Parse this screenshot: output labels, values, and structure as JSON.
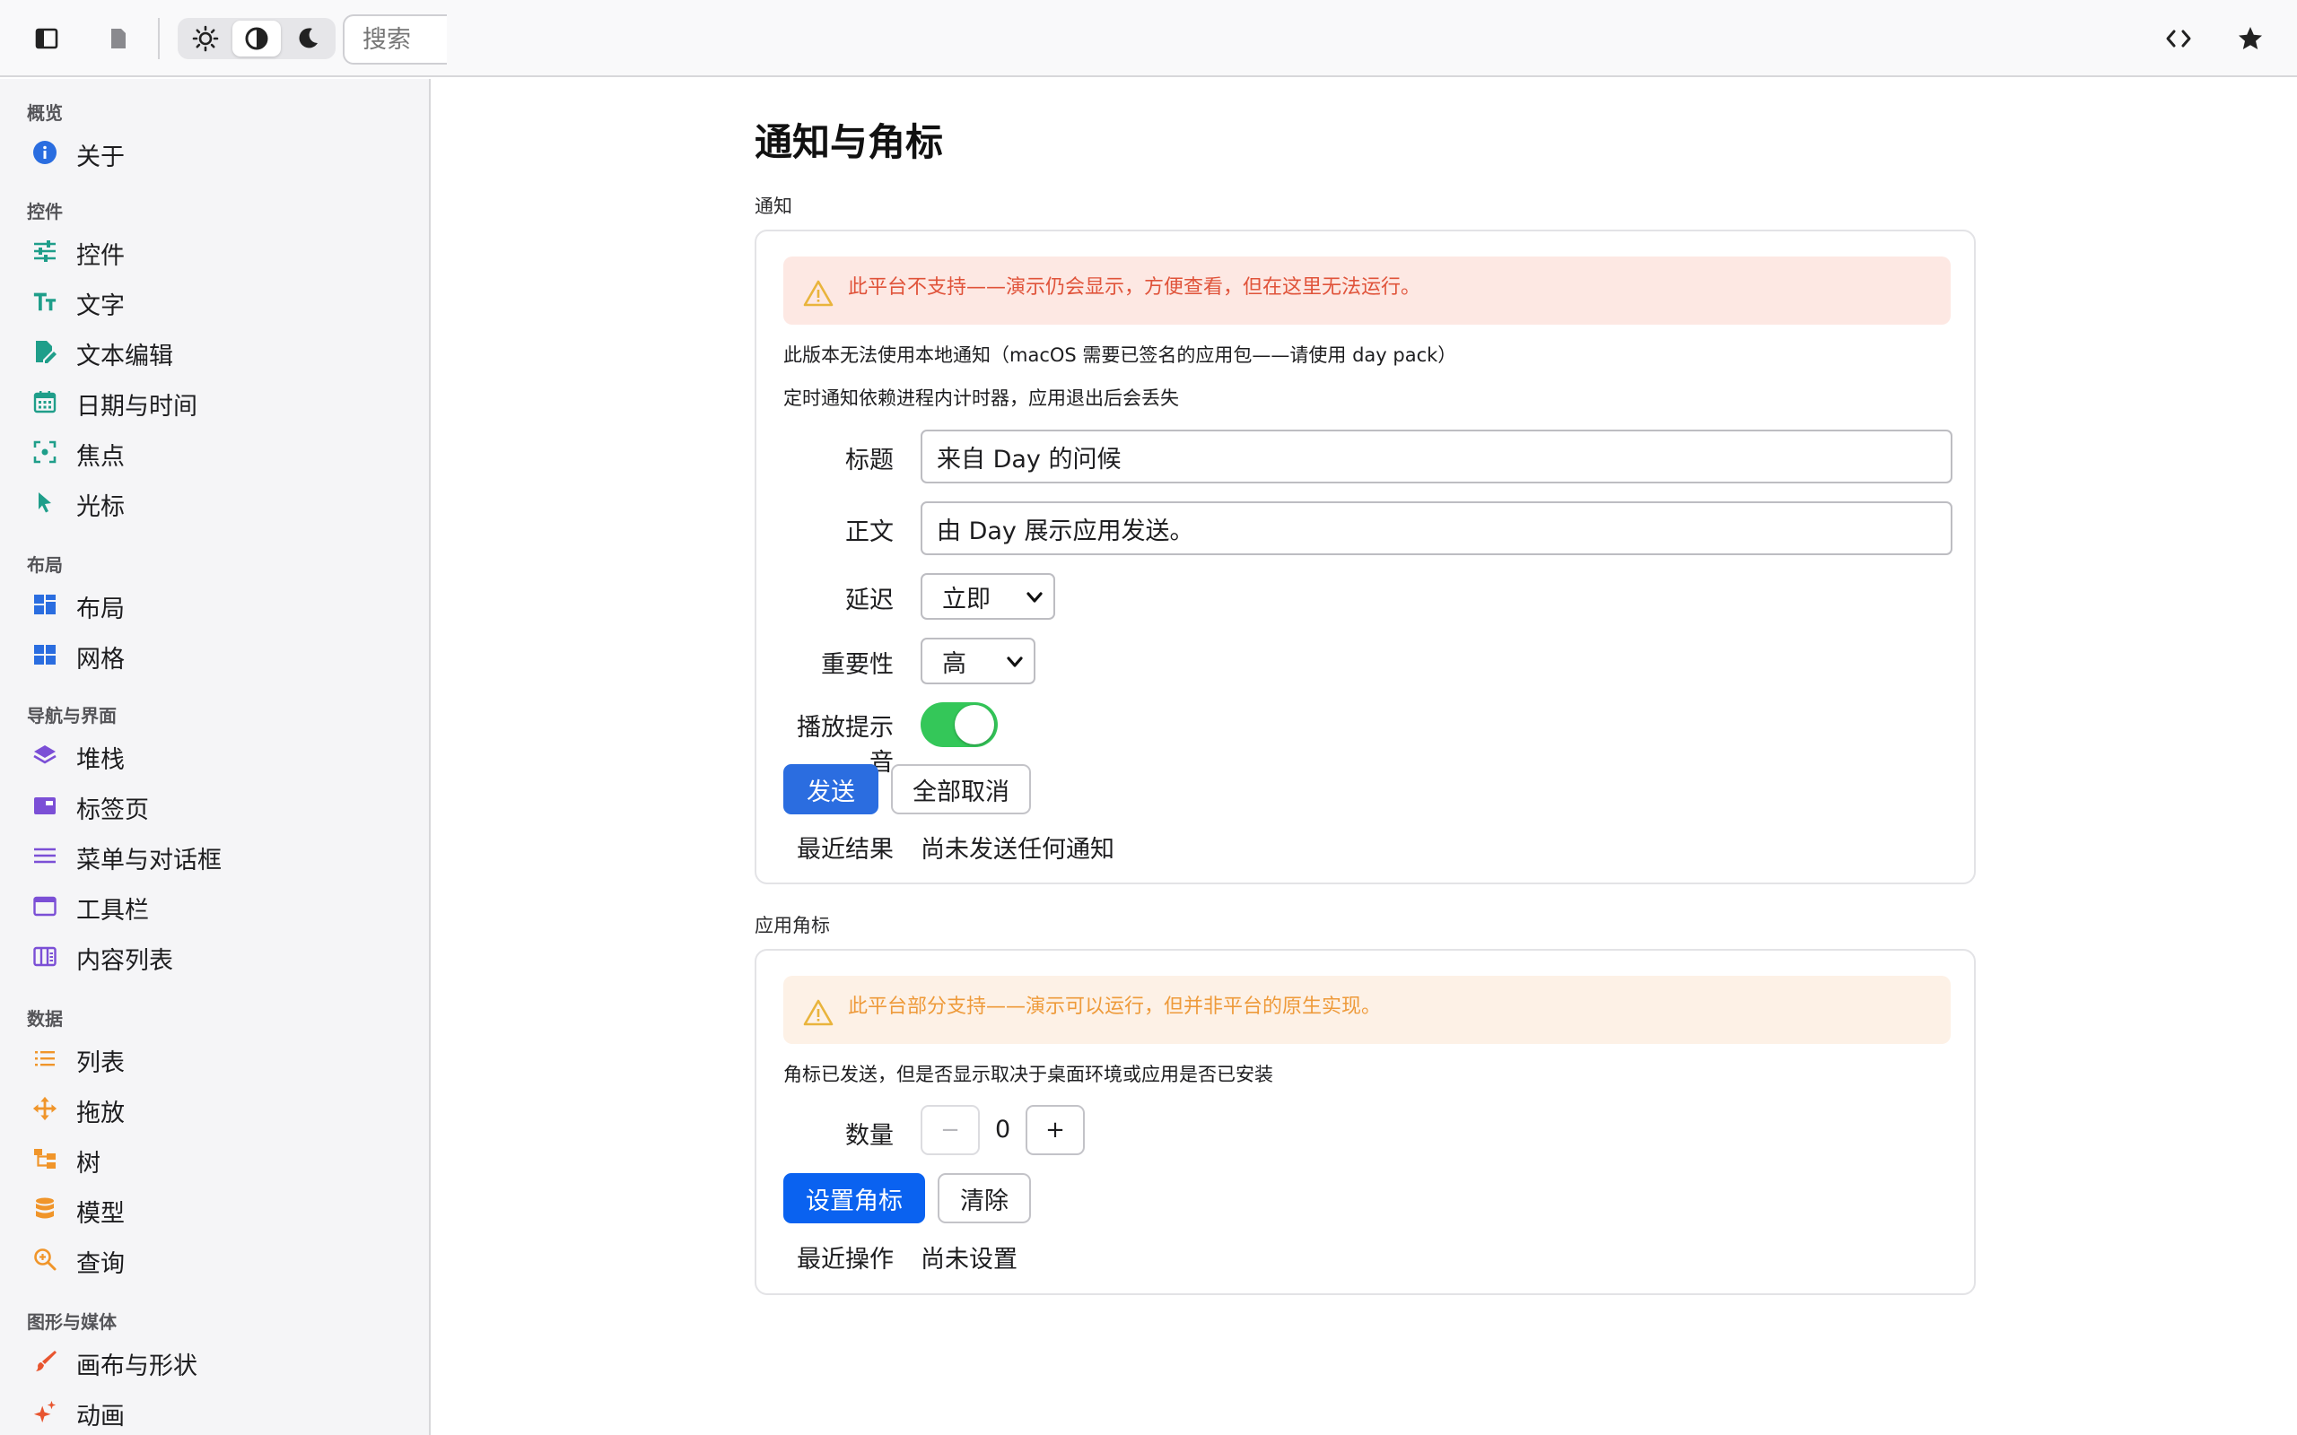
{
  "toolbar": {
    "search_placeholder": "搜索"
  },
  "sidebar": {
    "sections": [
      {
        "title": "概览",
        "items": [
          {
            "label": "关于",
            "icon": "info-icon",
            "color": "#2a6de0"
          }
        ]
      },
      {
        "title": "控件",
        "items": [
          {
            "label": "控件",
            "icon": "sliders-icon",
            "color": "#1f9e8a"
          },
          {
            "label": "文字",
            "icon": "text-size-icon",
            "color": "#1f9e8a"
          },
          {
            "label": "文本编辑",
            "icon": "edit-document-icon",
            "color": "#1f9e8a"
          },
          {
            "label": "日期与时间",
            "icon": "calendar-icon",
            "color": "#1f9e8a"
          },
          {
            "label": "焦点",
            "icon": "focus-icon",
            "color": "#1f9e8a"
          },
          {
            "label": "光标",
            "icon": "cursor-icon",
            "color": "#1f9e8a"
          }
        ]
      },
      {
        "title": "布局",
        "items": [
          {
            "label": "布局",
            "icon": "layout-icon",
            "color": "#2a6de0"
          },
          {
            "label": "网格",
            "icon": "grid-icon",
            "color": "#2a6de0"
          }
        ]
      },
      {
        "title": "导航与界面",
        "items": [
          {
            "label": "堆栈",
            "icon": "stack-icon",
            "color": "#7b4fd6"
          },
          {
            "label": "标签页",
            "icon": "tabs-icon",
            "color": "#7b4fd6"
          },
          {
            "label": "菜单与对话框",
            "icon": "menu-icon",
            "color": "#7b4fd6"
          },
          {
            "label": "工具栏",
            "icon": "toolbar-icon",
            "color": "#7b4fd6"
          },
          {
            "label": "内容列表",
            "icon": "content-list-icon",
            "color": "#7b4fd6"
          }
        ]
      },
      {
        "title": "数据",
        "items": [
          {
            "label": "列表",
            "icon": "list-icon",
            "color": "#f0952a"
          },
          {
            "label": "拖放",
            "icon": "move-icon",
            "color": "#f0952a"
          },
          {
            "label": "树",
            "icon": "tree-icon",
            "color": "#f0952a"
          },
          {
            "label": "模型",
            "icon": "database-icon",
            "color": "#f0952a"
          },
          {
            "label": "查询",
            "icon": "zoom-search-icon",
            "color": "#f0952a"
          }
        ]
      },
      {
        "title": "图形与媒体",
        "items": [
          {
            "label": "画布与形状",
            "icon": "brush-icon",
            "color": "#e8552f"
          },
          {
            "label": "动画",
            "icon": "sparkle-icon",
            "color": "#e8552f"
          }
        ]
      }
    ]
  },
  "main": {
    "title": "通知与角标",
    "notifications": {
      "section_label": "通知",
      "banner": "此平台不支持——演示仍会显示，方便查看，但在这里无法运行。",
      "note1": "此版本无法使用本地通知（macOS 需要已签名的应用包——请使用 day pack）",
      "note2": "定时通知依赖进程内计时器，应用退出后会丢失",
      "title_label": "标题",
      "title_value": "来自 Day 的问候",
      "body_label": "正文",
      "body_value": "由 Day 展示应用发送。",
      "delay_label": "延迟",
      "delay_value": "立即",
      "importance_label": "重要性",
      "importance_value": "高",
      "sound_label": "播放提示音",
      "sound_on": true,
      "send_label": "发送",
      "cancel_all_label": "全部取消",
      "result_label": "最近结果",
      "result_value": "尚未发送任何通知"
    },
    "badge": {
      "section_label": "应用角标",
      "banner": "此平台部分支持——演示可以运行，但并非平台的原生实现。",
      "note": "角标已发送，但是否显示取决于桌面环境或应用是否已安装",
      "count_label": "数量",
      "minus": "−",
      "count_value": "0",
      "plus": "+",
      "set_label": "设置角标",
      "clear_label": "清除",
      "action_label": "最近操作",
      "action_value": "尚未设置"
    }
  },
  "colors": {
    "error_banner_bg": "#fde8e3",
    "error_banner_text": "#e0533a",
    "warn_banner_bg": "#fdf1e6",
    "warn_banner_text": "#ee9a3a",
    "warn_icon": "#e9b43c",
    "toggle_on": "#34c759"
  }
}
